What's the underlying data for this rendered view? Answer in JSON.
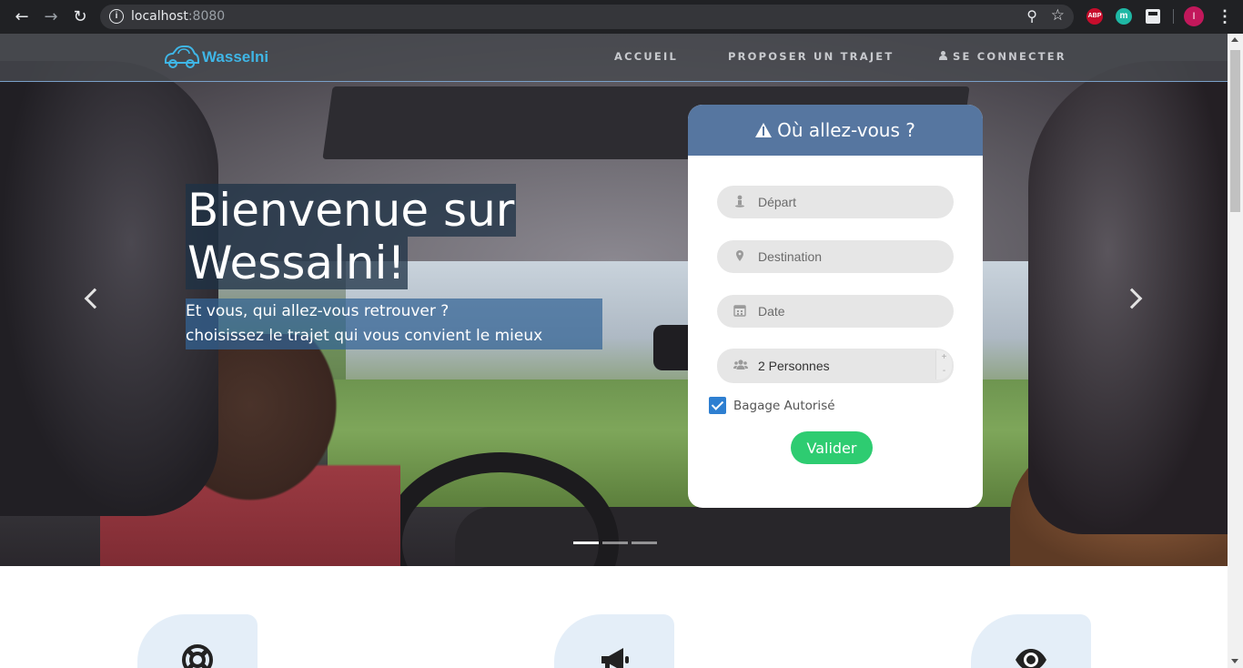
{
  "browser": {
    "url_host": "localhost",
    "url_port": ":8080",
    "icons": [
      "back-icon",
      "forward-icon",
      "reload-icon",
      "info-icon",
      "zoom-icon",
      "star-icon",
      "abp-extension-icon",
      "m-extension-icon",
      "grid-extension-icon",
      "profile-avatar",
      "menu-kebab-icon"
    ],
    "extensions": {
      "abp": "ABP",
      "m": "m"
    },
    "avatar_initial": "I"
  },
  "navbar": {
    "brand": "Wasselni",
    "links": [
      "ACCUEIL",
      "PROPOSER UN TRAJET",
      "SE CONNECTER"
    ]
  },
  "hero": {
    "title_line1": "Bienvenue sur",
    "title_line2": "Wessalni!",
    "subtitle_line1": "Et vous, qui allez-vous retrouver ?",
    "subtitle_line2": "choisissez le trajet qui vous convient le mieux",
    "slides_count": 3,
    "active_slide": 1
  },
  "search": {
    "heading": "Où allez-vous ?",
    "depart_placeholder": "Départ",
    "destination_placeholder": "Destination",
    "date_placeholder": "Date",
    "persons_value": "2 Personnes",
    "baggage_label": "Bagage Autorisé",
    "baggage_checked": true,
    "submit_label": "Valider"
  },
  "features": [
    {
      "icon": "lifebuoy-icon"
    },
    {
      "icon": "megaphone-icon"
    },
    {
      "icon": "eye-icon"
    }
  ],
  "colors": {
    "brand": "#3fb6e6",
    "card_header": "#5676a0",
    "submit": "#2ecc71",
    "checkbox": "#2e7fd1"
  }
}
